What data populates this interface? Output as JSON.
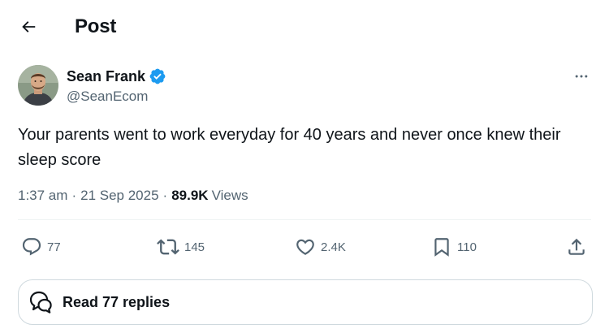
{
  "header": {
    "title": "Post"
  },
  "author": {
    "name": "Sean Frank",
    "handle": "@SeanEcom",
    "verified": true
  },
  "tweet": {
    "text": "Your parents went to work everyday for 40 years and never once knew their sleep score",
    "time": "1:37 am",
    "date": "21 Sep 2025",
    "views_count": "89.9K",
    "views_label": "Views"
  },
  "actions": {
    "replies": "77",
    "reposts": "145",
    "likes": "2.4K",
    "bookmarks": "110"
  },
  "read_replies": {
    "label": "Read 77 replies"
  },
  "colors": {
    "text": "#0f1419",
    "secondary": "#536471",
    "verified": "#1d9bf0",
    "border": "#cfd9de"
  },
  "icons": [
    "back-arrow-icon",
    "verified-badge-icon",
    "more-icon",
    "reply-icon",
    "repost-icon",
    "like-icon",
    "bookmark-icon",
    "share-icon",
    "speech-bubbles-icon"
  ]
}
